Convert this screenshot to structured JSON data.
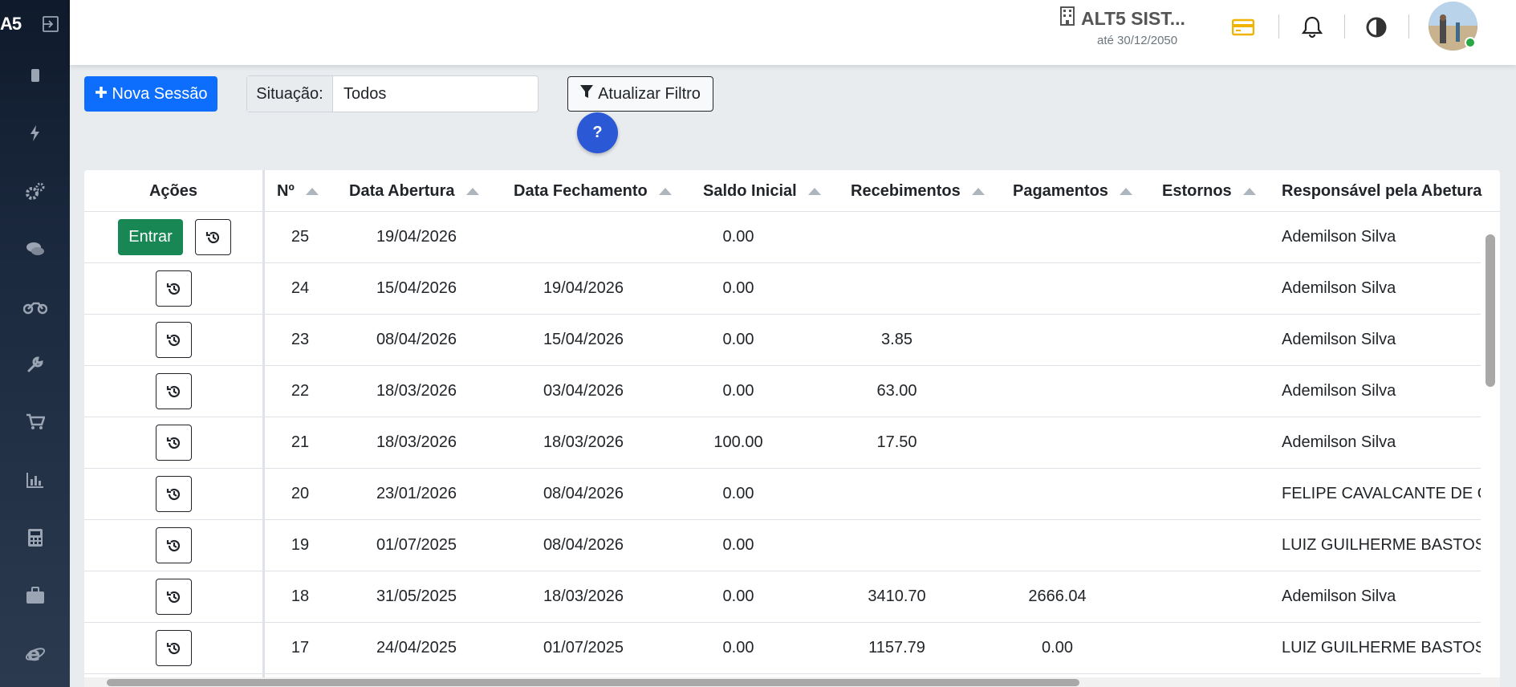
{
  "app": {
    "logo_text": "A5",
    "company_name": "ALT5 SIST...",
    "license_until": "até 30/12/2050"
  },
  "sidebar": {
    "icons": [
      "mobile-icon",
      "bolt-icon",
      "gears-icon",
      "comments-icon",
      "motorcycle-icon",
      "wrench-icon",
      "cart-icon",
      "chart-icon",
      "calculator-icon",
      "briefcase-icon",
      "internet-explorer-icon"
    ]
  },
  "toolbar": {
    "nova_sessao_label": "Nova Sessão",
    "situacao_label": "Situação:",
    "situacao_value": "Todos",
    "atualizar_label": "Atualizar Filtro",
    "help_label": "?"
  },
  "table": {
    "columns": [
      "Ações",
      "Nº",
      "Data Abertura",
      "Data Fechamento",
      "Saldo Inicial",
      "Recebimentos",
      "Pagamentos",
      "Estornos",
      "Responsável pela Abetura"
    ],
    "entrar_label": "Entrar",
    "rows": [
      {
        "num": "25",
        "abertura": "19/04/2026",
        "fechamento": "",
        "saldo": "0.00",
        "receb": "",
        "pag": "",
        "estornos": "",
        "resp": "Ademilson Silva",
        "open": true
      },
      {
        "num": "24",
        "abertura": "15/04/2026",
        "fechamento": "19/04/2026",
        "saldo": "0.00",
        "receb": "",
        "pag": "",
        "estornos": "",
        "resp": "Ademilson Silva",
        "open": false
      },
      {
        "num": "23",
        "abertura": "08/04/2026",
        "fechamento": "15/04/2026",
        "saldo": "0.00",
        "receb": "3.85",
        "pag": "",
        "estornos": "",
        "resp": "Ademilson Silva",
        "open": false
      },
      {
        "num": "22",
        "abertura": "18/03/2026",
        "fechamento": "03/04/2026",
        "saldo": "0.00",
        "receb": "63.00",
        "pag": "",
        "estornos": "",
        "resp": "Ademilson Silva",
        "open": false
      },
      {
        "num": "21",
        "abertura": "18/03/2026",
        "fechamento": "18/03/2026",
        "saldo": "100.00",
        "receb": "17.50",
        "pag": "",
        "estornos": "",
        "resp": "Ademilson Silva",
        "open": false
      },
      {
        "num": "20",
        "abertura": "23/01/2026",
        "fechamento": "08/04/2026",
        "saldo": "0.00",
        "receb": "",
        "pag": "",
        "estornos": "",
        "resp": "FELIPE CAVALCANTE DE OL",
        "open": false
      },
      {
        "num": "19",
        "abertura": "01/07/2025",
        "fechamento": "08/04/2026",
        "saldo": "0.00",
        "receb": "",
        "pag": "",
        "estornos": "",
        "resp": "LUIZ GUILHERME BASTOS F",
        "open": false
      },
      {
        "num": "18",
        "abertura": "31/05/2025",
        "fechamento": "18/03/2026",
        "saldo": "0.00",
        "receb": "3410.70",
        "pag": "2666.04",
        "estornos": "",
        "resp": "Ademilson Silva",
        "open": false
      },
      {
        "num": "17",
        "abertura": "24/04/2025",
        "fechamento": "01/07/2025",
        "saldo": "0.00",
        "receb": "1157.79",
        "pag": "0.00",
        "estornos": "",
        "resp": "LUIZ GUILHERME BASTOS F",
        "open": false
      }
    ]
  },
  "colors": {
    "primary": "#0d6efd",
    "success": "#198754",
    "help": "#2b59d6",
    "card_icon": "#f0b400"
  }
}
